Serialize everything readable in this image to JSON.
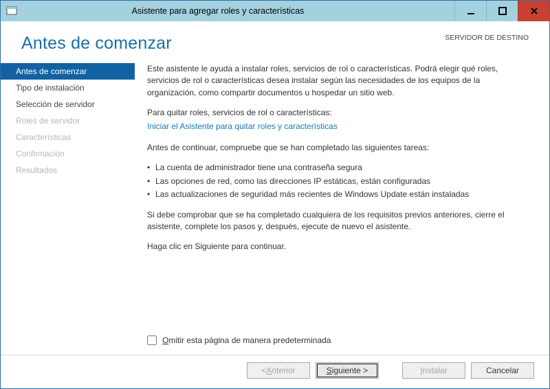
{
  "titlebar": {
    "title": "Asistente para agregar roles y características"
  },
  "header": {
    "page_title": "Antes de comenzar",
    "dest_label": "SERVIDOR DE DESTINO",
    "dest_value": " "
  },
  "sidebar": {
    "items": [
      {
        "label": "Antes de comenzar",
        "state": "active"
      },
      {
        "label": "Tipo de instalación",
        "state": "normal"
      },
      {
        "label": "Selección de servidor",
        "state": "normal"
      },
      {
        "label": "Roles de servidor",
        "state": "disabled"
      },
      {
        "label": "Características",
        "state": "disabled"
      },
      {
        "label": "Confirmación",
        "state": "disabled"
      },
      {
        "label": "Resultados",
        "state": "disabled"
      }
    ]
  },
  "content": {
    "intro": "Este asistente le ayuda a instalar roles, servicios de rol o características. Podrá elegir qué roles, servicios de rol o características desea instalar según las necesidades de los equipos de la organización, como compartir documentos u hospedar un sitio web.",
    "remove_label": "Para quitar roles, servicios de rol o características:",
    "remove_link": "Iniciar el Asistente para quitar roles y características",
    "precheck_label": "Antes de continuar, compruebe que se han completado las siguientes tareas:",
    "checks": [
      "La cuenta de administrador tiene una contraseña segura",
      "Las opciones de red, como las direcciones IP estáticas, están configuradas",
      "Las actualizaciones de seguridad más recientes de Windows Update están instaladas"
    ],
    "verify": "Si debe comprobar que se ha completado cualquiera de los requisitos previos anteriores, cierre el asistente, complete los pasos y, después, ejecute de nuevo el asistente.",
    "proceed": "Haga clic en Siguiente para continuar.",
    "skip_prefix": "O",
    "skip_rest": "mitir esta página de manera predeterminada"
  },
  "footer": {
    "back_prefix": "< ",
    "back_u": "A",
    "back_rest": "nterior",
    "next_u": "S",
    "next_rest": "iguiente >",
    "install_u": "I",
    "install_rest": "nstalar",
    "cancel": "Cancelar"
  }
}
